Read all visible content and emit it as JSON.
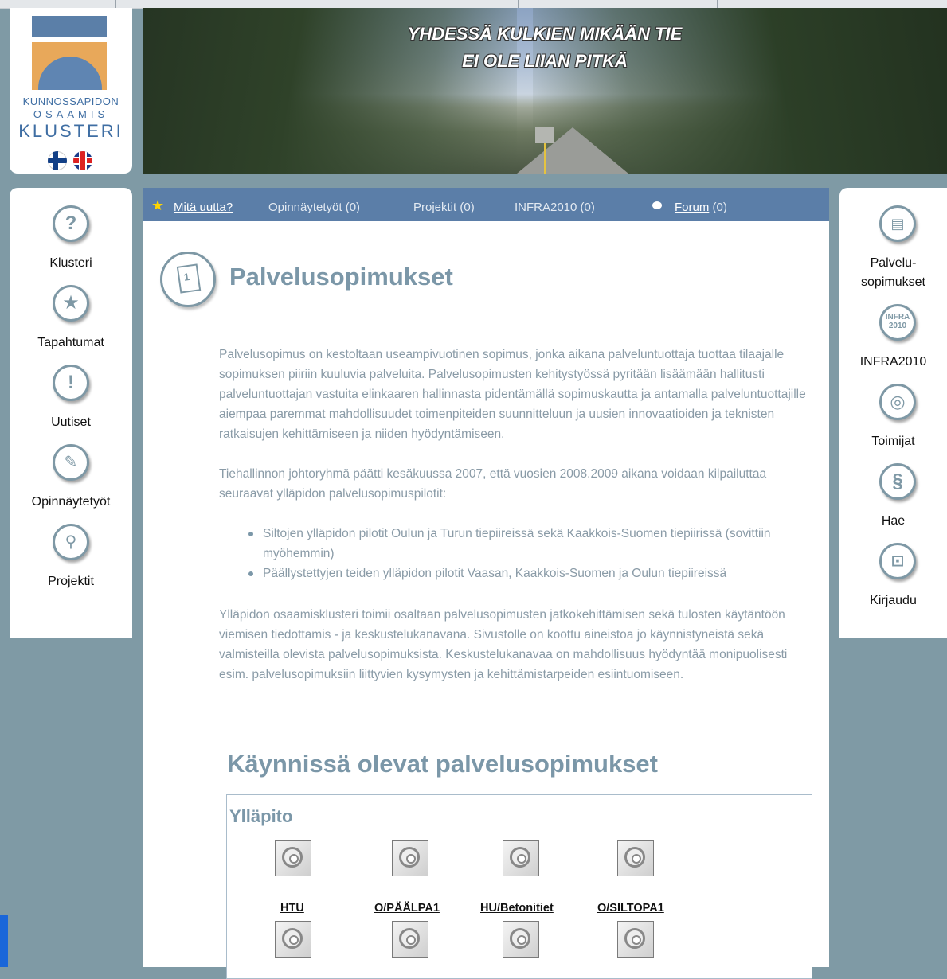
{
  "logo": {
    "line1": "KUNNOSSAPIDON",
    "line2": "OSAAMIS",
    "line3": "KLUSTERI"
  },
  "banner": {
    "line1": "YHDESSÄ KULKIEN MIKÄÄN TIE",
    "line2": "EI OLE LIIAN PITKÄ"
  },
  "left_nav": [
    {
      "label": "Klusteri",
      "icon": "question-icon"
    },
    {
      "label": "Tapahtumat",
      "icon": "star-icon"
    },
    {
      "label": "Uutiset",
      "icon": "exclamation-icon"
    },
    {
      "label": "Opinnäytetyöt",
      "icon": "pencil-icon"
    },
    {
      "label": "Projektit",
      "icon": "key-icon"
    }
  ],
  "right_nav": [
    {
      "label1": "Palvelu-",
      "label2": "sopimukset",
      "icon": "contract-icon"
    },
    {
      "label": "INFRA2010",
      "icon": "infra2010-icon",
      "icon_text": "INFRA 2010"
    },
    {
      "label": "Toimijat",
      "icon": "globe-icon"
    },
    {
      "label": "Hae",
      "icon": "section-icon"
    },
    {
      "label": "Kirjaudu",
      "icon": "lock-icon"
    }
  ],
  "tabs": {
    "whats_new": "Mitä uutta?",
    "theses": "Opinnäytetyöt (0)",
    "projects": "Projektit (0)",
    "infra": "INFRA2010 (0)",
    "forum": "Forum",
    "forum_count": " (0)"
  },
  "page": {
    "title": "Palvelusopimukset",
    "para1": "Palvelusopimus on kestoltaan useampivuotinen sopimus, jonka aikana palveluntuottaja tuottaa tilaajalle sopimuksen piiriin kuuluvia palveluita. Palvelusopimusten kehitystyössä pyritään lisäämään hallitusti palveluntuottajan vastuita elinkaaren hallinnasta pidentämällä sopimuskautta ja antamalla palveluntuottajille aiempaa paremmat mahdollisuudet toimenpiteiden suunnitteluun ja uusien innovaatioiden ja teknisten ratkaisujen kehittämiseen ja niiden hyödyntämiseen.",
    "para2": "Tiehallinnon johtoryhmä päätti kesäkuussa 2007, että vuosien 2008.2009 aikana voidaan kilpailuttaa seuraavat ylläpidon palvelusopimuspilotit:",
    "bullets": [
      "Siltojen ylläpidon pilotit Oulun ja Turun tiepiireissä sekä Kaakkois-Suomen tiepiirissä (sovittiin myöhemmin)",
      "Päällystettyjen teiden ylläpidon pilotit Vaasan, Kaakkois-Suomen ja Oulun tiepiireissä"
    ],
    "para3": "Ylläpidon osaamisklusteri toimii osaltaan palvelusopimusten jatkokehittämisen sekä tulosten käytäntöön viemisen tiedottamis - ja keskustelukanavana. Sivustolle on koottu aineistoa jo käynnistyneistä sekä valmisteilla olevista palvelusopimuksista. Keskustelukanavaa on mahdollisuus hyödyntää monipuolisesti esim. palvelusopimuksiin liittyvien kysymysten ja kehittämistarpeiden esiintuomiseen.",
    "section_title": "Käynnissä olevat palvelusopimukset",
    "box_title": "Ylläpito",
    "projects": [
      "HTU",
      "O/PÄÄLPA1",
      "HU/Betonitiet",
      "O/SILTOPA1"
    ]
  }
}
